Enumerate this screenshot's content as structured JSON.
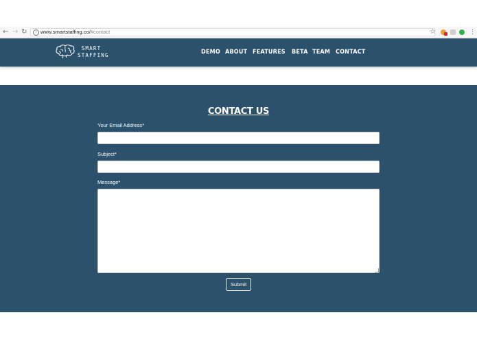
{
  "browser": {
    "url_host": "www.smartstaffing.co/",
    "url_fragment": "#contact",
    "nav_icons": [
      "back-icon",
      "forward-icon",
      "reload-icon"
    ],
    "toolbar_icons": [
      "star-icon",
      "extension-icon",
      "extension-icon",
      "extension-icon",
      "menu-icon"
    ]
  },
  "header": {
    "logo": {
      "icon": "brain-icon",
      "line1": "SMART",
      "line2": "STAFFING"
    },
    "nav": [
      {
        "label": "DEMO"
      },
      {
        "label": "ABOUT"
      },
      {
        "label": "FEATURES"
      },
      {
        "label": "BETA"
      },
      {
        "label": "TEAM"
      },
      {
        "label": "CONTACT"
      }
    ]
  },
  "contact": {
    "title": "CONTACT US",
    "email_label": "Your Email Address*",
    "email_value": "",
    "subject_label": "Subject*",
    "subject_value": "",
    "message_label": "Message*",
    "message_value": "",
    "submit_label": "Submit"
  },
  "colors": {
    "brand_navy": "#2b516d",
    "text_on_brand": "#ffffff"
  }
}
